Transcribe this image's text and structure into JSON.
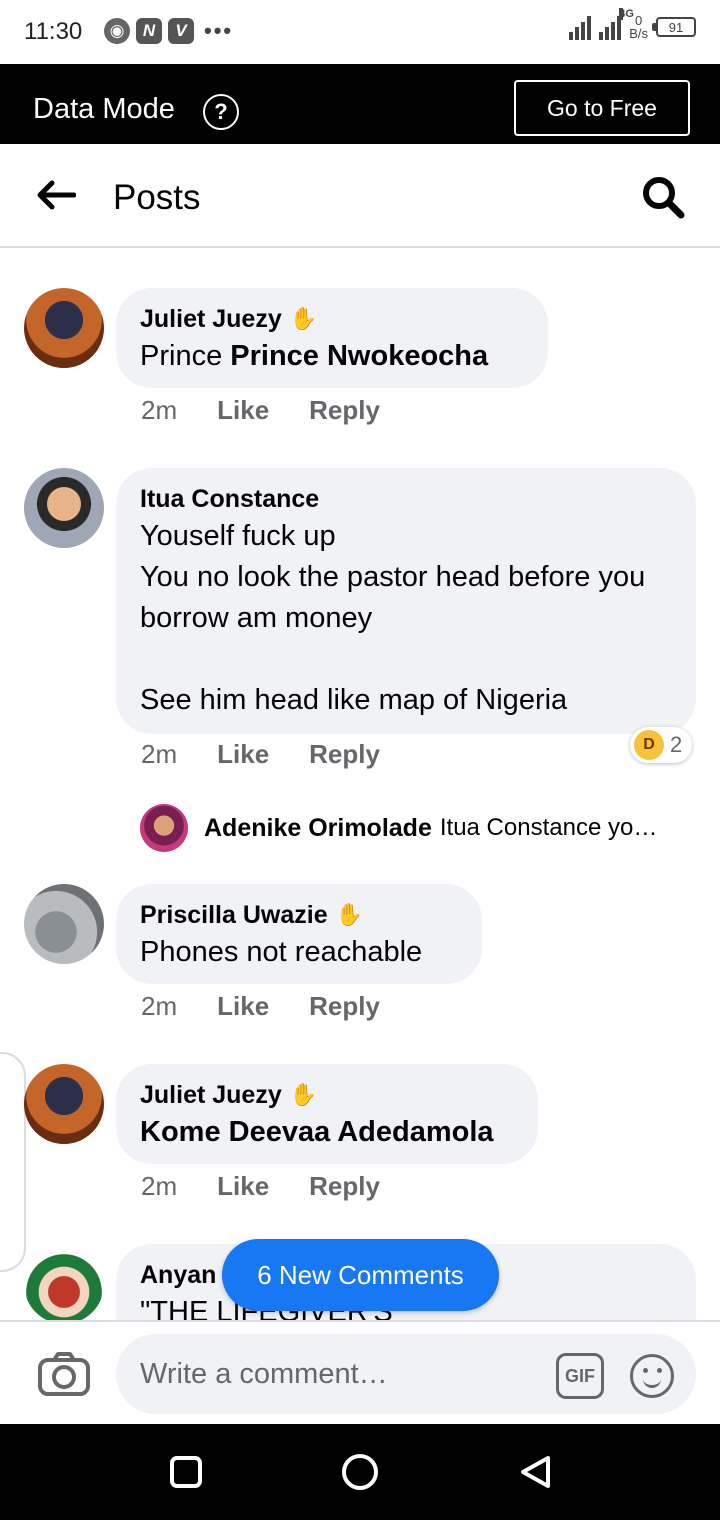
{
  "status_bar": {
    "time": "11:30",
    "net_type": "4G",
    "speed_value": "0",
    "speed_unit": "B/s",
    "battery": "91",
    "app_icons": [
      "chrome-icon",
      "n-app-icon",
      "v-app-icon"
    ]
  },
  "data_mode_bar": {
    "title": "Data Mode",
    "help_icon": "?",
    "go_free_label": "Go to Free"
  },
  "header": {
    "title": "Posts"
  },
  "comments": [
    {
      "author": "Juliet Juezy",
      "prefix": "Prince ",
      "mention": "Prince Nwokeocha",
      "time": "2m",
      "like": "Like",
      "reply": "Reply"
    },
    {
      "author": "Itua Constance",
      "text": "Youself fuck up\nYou no look the pastor head before you borrow am money\n\nSee him head like map of Nigeria",
      "time": "2m",
      "like": "Like",
      "reply": "Reply",
      "reaction_count": "2",
      "reply_preview": {
        "author": "Adenike Orimolade",
        "text": "Itua Constance yo…"
      }
    },
    {
      "author": "Priscilla Uwazie",
      "text": "Phones not reachable",
      "time": "2m",
      "like": "Like",
      "reply": "Reply"
    },
    {
      "author": "Juliet Juezy",
      "mention": "Kome Deevaa Adedamola",
      "time": "2m",
      "like": "Like",
      "reply": "Reply"
    },
    {
      "author": "Anyan",
      "text": "\"THE LIFEGIVER'S"
    }
  ],
  "new_comments_label": "6 New Comments",
  "composer": {
    "placeholder": "Write a comment…",
    "gif_label": "GIF"
  },
  "colors": {
    "accent": "#1877f2",
    "bubble": "#f0f2f5",
    "secondary_text": "#65676b"
  }
}
